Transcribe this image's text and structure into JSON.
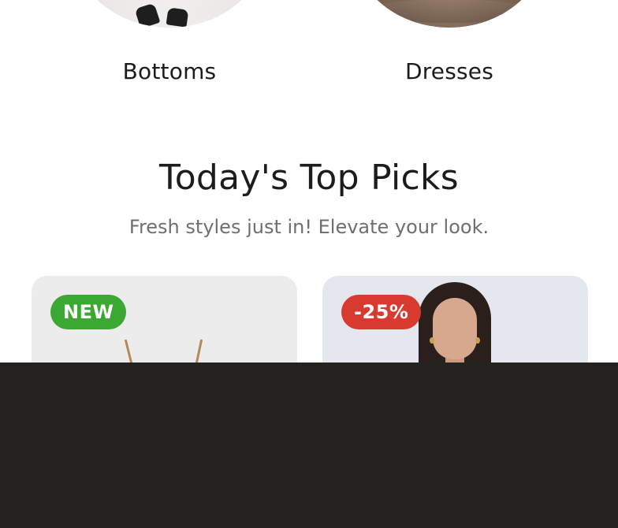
{
  "categories": [
    {
      "label": "Bottoms"
    },
    {
      "label": "Dresses"
    }
  ],
  "top_picks": {
    "title": "Today's Top Picks",
    "subtitle": "Fresh styles just in! Elevate your look."
  },
  "products": [
    {
      "badge": "NEW",
      "badge_color": "#3aa832"
    },
    {
      "badge": "-25%",
      "badge_color": "#d93a2f"
    }
  ],
  "colors": {
    "text_primary": "#1c1c1c",
    "text_secondary": "#6f6f6f",
    "overlay": "#242322"
  }
}
